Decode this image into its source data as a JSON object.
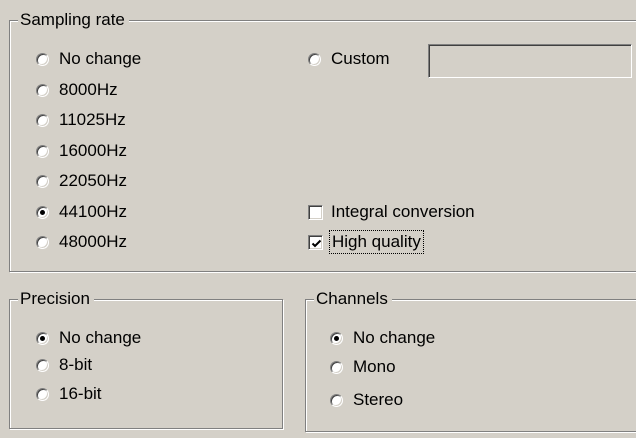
{
  "sampling_rate": {
    "title": "Sampling rate",
    "options": [
      {
        "label": "No change",
        "checked": false
      },
      {
        "label": "8000Hz",
        "checked": false
      },
      {
        "label": "11025Hz",
        "checked": false
      },
      {
        "label": "16000Hz",
        "checked": false
      },
      {
        "label": "22050Hz",
        "checked": false
      },
      {
        "label": "44100Hz",
        "checked": true
      },
      {
        "label": "48000Hz",
        "checked": false
      }
    ],
    "custom": {
      "label": "Custom",
      "checked": false,
      "value": ""
    },
    "integral_conversion": {
      "label": "Integral conversion",
      "checked": false
    },
    "high_quality": {
      "label": "High quality",
      "checked": true
    }
  },
  "precision": {
    "title": "Precision",
    "options": [
      {
        "label": "No change",
        "checked": true
      },
      {
        "label": "8-bit",
        "checked": false
      },
      {
        "label": "16-bit",
        "checked": false
      }
    ]
  },
  "channels": {
    "title": "Channels",
    "options": [
      {
        "label": "No change",
        "checked": true
      },
      {
        "label": "Mono",
        "checked": false
      },
      {
        "label": "Stereo",
        "checked": false
      }
    ]
  }
}
